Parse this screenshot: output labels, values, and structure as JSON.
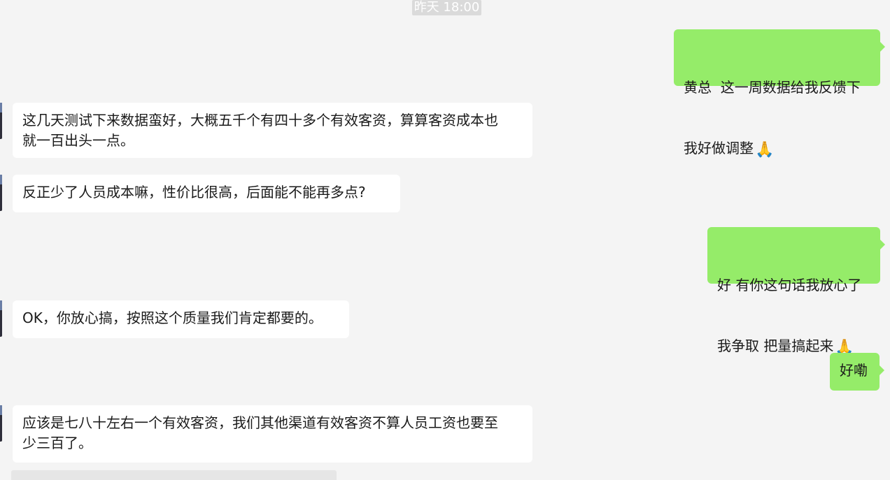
{
  "timestamp": "昨天 18:00",
  "messages": [
    {
      "side": "right",
      "line1": "黄总  这一周数据给我反馈下",
      "line2": "我好做调整",
      "emoji": "🙏"
    },
    {
      "side": "left",
      "text": "这几天测试下来数据蛮好，大概五千个有四十多个有效客资，算算客资成本也\n就一百出头一点。"
    },
    {
      "side": "left",
      "text": "反正少了人员成本嘛，性价比很高，后面能不能再多点?"
    },
    {
      "side": "right",
      "line1": "好 有你这句话我放心了",
      "line2": "我争取 把量搞起来",
      "emoji": "🙏"
    },
    {
      "side": "left",
      "text": "OK，你放心搞，按照这个质量我们肯定都要的。"
    },
    {
      "side": "right",
      "text": "好嘞"
    },
    {
      "side": "left",
      "text": "应该是七八十左右一个有效客资，我们其他渠道有效客资不算人员工资也要至\n少三百了。"
    }
  ]
}
